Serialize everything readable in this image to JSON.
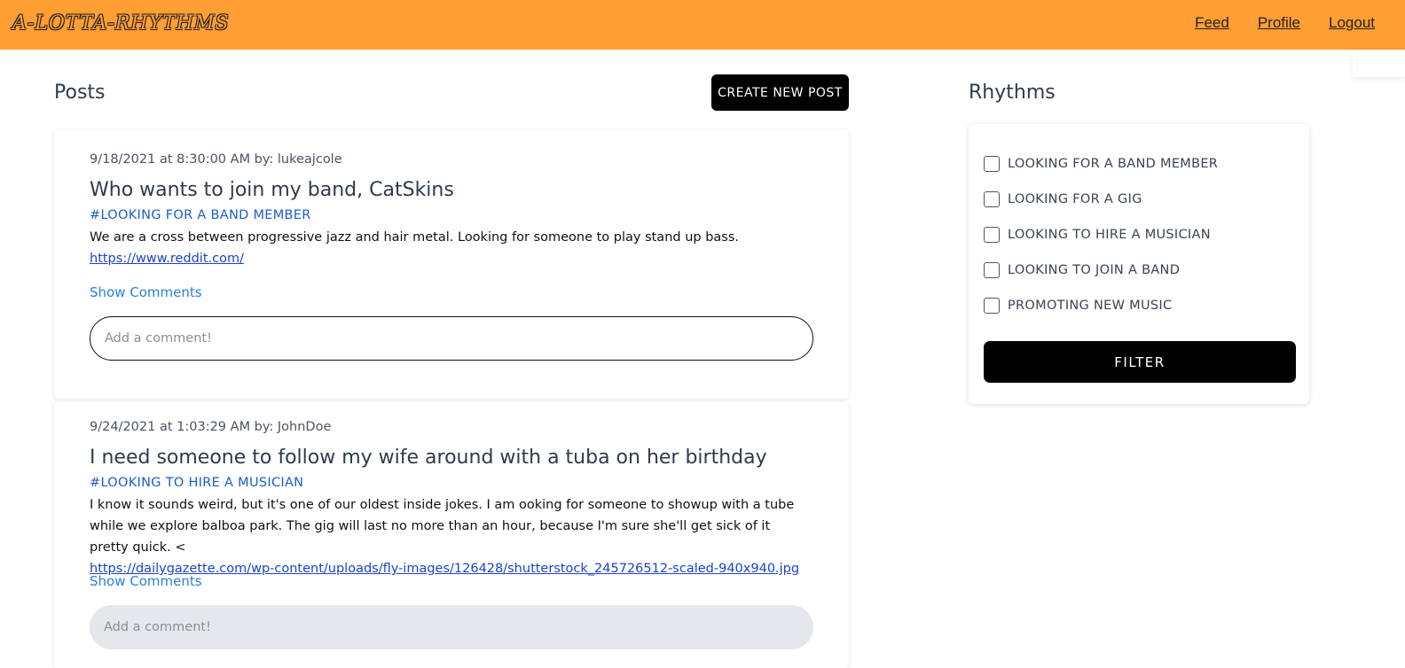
{
  "header": {
    "logo": "A-LOTTA-RHYTHMS",
    "nav": [
      "Feed",
      "Profile",
      "Logout"
    ]
  },
  "posts_section": {
    "title": "Posts",
    "create_label": "CREATE NEW POST"
  },
  "posts": [
    {
      "meta": "9/18/2021 at 8:30:00 AM by: lukeajcole",
      "title": "Who wants to join my band, CatSkins",
      "tag": "#LOOKING FOR A BAND MEMBER",
      "body": "We are a cross between progressive jazz and hair metal.  Looking for someone to play stand up bass.",
      "link": "https://www.reddit.com/",
      "show_comments": "Show Comments",
      "comment_placeholder": "Add a comment!"
    },
    {
      "meta": "9/24/2021 at 1:03:29 AM by: JohnDoe",
      "title": "I need someone to follow my wife around with a tuba on her birthday",
      "tag": "#LOOKING TO HIRE A MUSICIAN",
      "body": "I know it sounds weird, but it's one of our oldest inside jokes.  I am ooking for someone to showup with a tube while we explore balboa park. The gig will last no more than an hour, because  I'm sure she'll get sick of it pretty quick. <",
      "link": "https://dailygazette.com/wp-content/uploads/fly-images/126428/shutterstock_245726512-scaled-940x940.jpg",
      "show_comments": "Show Comments",
      "comment_placeholder": "Add a comment!"
    }
  ],
  "rhythms": {
    "title": "Rhythms",
    "filters": [
      "LOOKING FOR A BAND MEMBER",
      "LOOKING FOR A GIG",
      "LOOKING TO HIRE A MUSICIAN",
      "LOOKING TO JOIN A BAND",
      "PROMOTING NEW MUSIC"
    ],
    "filter_button": "FILTER"
  }
}
